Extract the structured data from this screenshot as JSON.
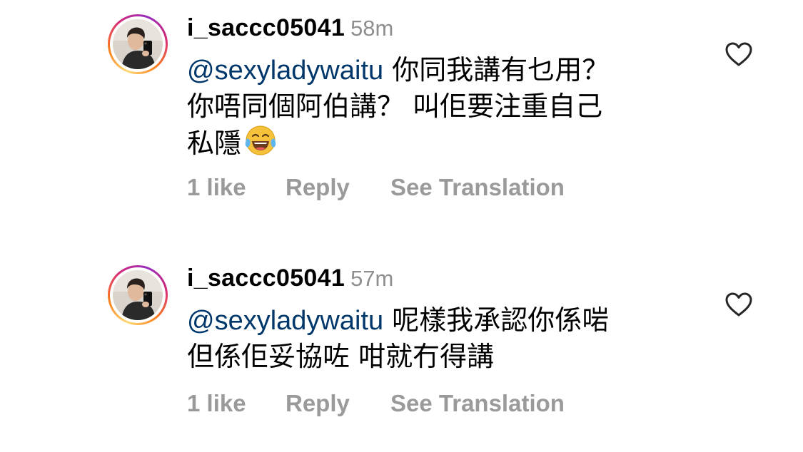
{
  "comments": [
    {
      "username": "i_saccc05041",
      "time": "58m",
      "mention": "@sexyladywaitu",
      "text_lines": [
        "你同我講有乜用？",
        "你唔同個阿伯講？ 叫佢要注重自己",
        "私隱"
      ],
      "emoji": "face-with-tears-of-joy",
      "likes": "1 like",
      "reply": "Reply",
      "translate": "See Translation"
    },
    {
      "username": "i_saccc05041",
      "time": "57m",
      "mention": "@sexyladywaitu",
      "text_lines": [
        "呢樣我承認你係啱",
        "但係佢妥協咗 咁就冇得講"
      ],
      "likes": "1 like",
      "reply": "Reply",
      "translate": "See Translation"
    }
  ],
  "colors": {
    "mention": "#00376b",
    "meta_gray": "#8e8e8e",
    "action_gray": "#9a9a9a",
    "ring_gradient": [
      "#feda75",
      "#fa7e1e",
      "#d62976",
      "#962fbf"
    ]
  },
  "icons": {
    "like": "heart-outline-icon",
    "emoji": "face-with-tears-of-joy"
  }
}
